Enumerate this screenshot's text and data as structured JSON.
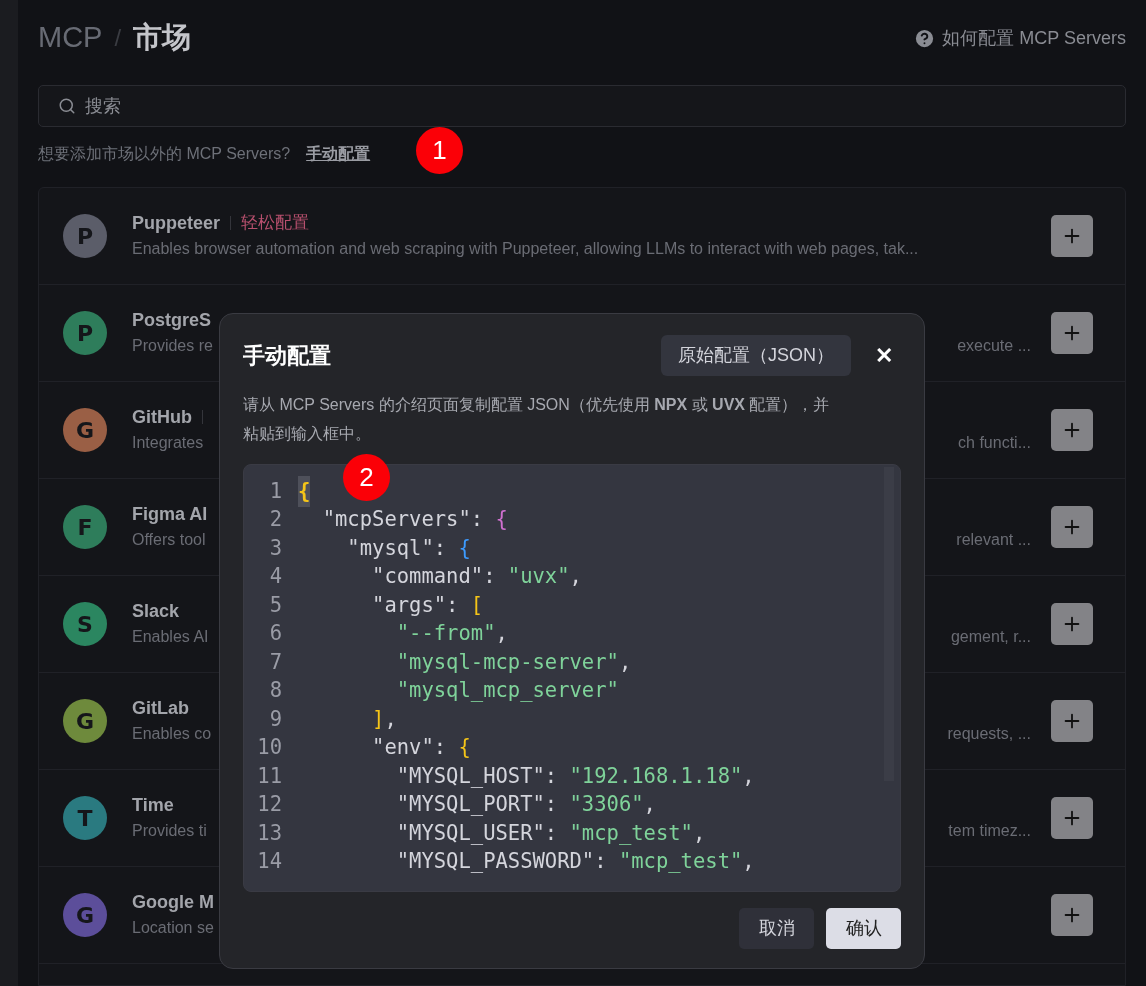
{
  "header": {
    "crumb": "MCP",
    "separator": "/",
    "title": "市场",
    "help_link": "如何配置 MCP Servers"
  },
  "search": {
    "placeholder": "搜索"
  },
  "hint": {
    "text": "想要添加市场以外的 MCP Servers?",
    "link": "手动配置"
  },
  "servers": [
    {
      "letter": "P",
      "color": "#5b5d69",
      "name": "Puppeteer",
      "has_tag": true,
      "tag": "轻松配置",
      "desc_start": "Enables browser automation and web scraping with Puppeteer, allowing LLMs to interact with web pages, tak..."
    },
    {
      "letter": "P",
      "color": "#2e7d5b",
      "name": "PostgreS",
      "has_tag": false,
      "desc_start": "Provides re",
      "desc_end": "execute ..."
    },
    {
      "letter": "G",
      "color": "#9a5f45",
      "name": "GitHub",
      "has_tag": true,
      "desc_start": "Integrates",
      "desc_end": "ch functi..."
    },
    {
      "letter": "F",
      "color": "#2e7d5b",
      "name": "Figma AI",
      "has_tag": false,
      "desc_start": "Offers tool",
      "desc_end": "relevant ..."
    },
    {
      "letter": "S",
      "color": "#2b8660",
      "name": "Slack",
      "has_tag": false,
      "desc_start": "Enables AI",
      "desc_end": "gement, r..."
    },
    {
      "letter": "G",
      "color": "#6e8a3c",
      "name": "GitLab",
      "has_tag": false,
      "desc_start": "Enables co",
      "desc_end": "requests, ..."
    },
    {
      "letter": "T",
      "color": "#2a7a80",
      "name": "Time",
      "has_tag": false,
      "desc_start": "Provides ti",
      "desc_end": "tem timez..."
    },
    {
      "letter": "G",
      "color": "#5c4e9a",
      "name": "Google M",
      "desc_start": "Location se"
    }
  ],
  "dialog": {
    "title": "手动配置",
    "mode_button": "原始配置（JSON）",
    "close": "✕",
    "description": "请从 MCP Servers 的介绍页面复制配置 JSON（优先使用 **NPX** 或 **UVX** 配置），并粘贴到输入框中。",
    "code": [
      {
        "no": "1",
        "tokens": [
          {
            "kind": "bracket",
            "text": "{",
            "color": "#f5c518",
            "highlighted": true
          }
        ]
      },
      {
        "no": "2",
        "tokens": [
          {
            "kind": "key",
            "text": "  \"mcpServers\": "
          },
          {
            "kind": "bracket",
            "text": "{",
            "color": "#d070d0",
            "highlighted": false
          }
        ]
      },
      {
        "no": "3",
        "tokens": [
          {
            "kind": "key",
            "text": "    \"mysql\": "
          },
          {
            "kind": "bracket",
            "text": "{",
            "color": "#3d9bff",
            "highlighted": false
          }
        ]
      },
      {
        "no": "4",
        "tokens": [
          {
            "kind": "key",
            "text": "      \"command\": "
          },
          {
            "kind": "string",
            "text": "\"uvx\""
          },
          {
            "kind": "punct",
            "text": ","
          }
        ]
      },
      {
        "no": "5",
        "tokens": [
          {
            "kind": "key",
            "text": "      \"args\": "
          },
          {
            "kind": "bracket",
            "text": "[",
            "color": "#f5c518",
            "highlighted": false
          }
        ]
      },
      {
        "no": "6",
        "tokens": [
          {
            "kind": "string",
            "text": "        \"--from\""
          },
          {
            "kind": "punct",
            "text": ","
          }
        ]
      },
      {
        "no": "7",
        "tokens": [
          {
            "kind": "string",
            "text": "        \"mysql-mcp-server\""
          },
          {
            "kind": "punct",
            "text": ","
          }
        ]
      },
      {
        "no": "8",
        "tokens": [
          {
            "kind": "string",
            "text": "        \"mysql_mcp_server\""
          }
        ]
      },
      {
        "no": "9",
        "tokens": [
          {
            "kind": "bracket",
            "text": "      ]",
            "color": "#f5c518",
            "highlighted": false
          },
          {
            "kind": "punct",
            "text": ","
          }
        ]
      },
      {
        "no": "10",
        "tokens": [
          {
            "kind": "key",
            "text": "      \"env\": "
          },
          {
            "kind": "bracket",
            "text": "{",
            "color": "#f5c518",
            "highlighted": false
          }
        ]
      },
      {
        "no": "11",
        "tokens": [
          {
            "kind": "key",
            "text": "        \"MYSQL_HOST\": "
          },
          {
            "kind": "string",
            "text": "\"192.168.1.18\""
          },
          {
            "kind": "punct",
            "text": ","
          }
        ]
      },
      {
        "no": "12",
        "tokens": [
          {
            "kind": "key",
            "text": "        \"MYSQL_PORT\": "
          },
          {
            "kind": "string",
            "text": "\"3306\""
          },
          {
            "kind": "punct",
            "text": ","
          }
        ]
      },
      {
        "no": "13",
        "tokens": [
          {
            "kind": "key",
            "text": "        \"MYSQL_USER\": "
          },
          {
            "kind": "string",
            "text": "\"mcp_test\""
          },
          {
            "kind": "punct",
            "text": ","
          }
        ]
      },
      {
        "no": "14",
        "tokens": [
          {
            "kind": "key",
            "text": "        \"MYSQL_PASSWORD\": "
          },
          {
            "kind": "string",
            "text": "\"mcp_test\""
          },
          {
            "kind": "punct",
            "text": ","
          }
        ]
      }
    ],
    "cancel": "取消",
    "confirm": "确认"
  },
  "annotations": [
    {
      "label": "1"
    },
    {
      "label": "2"
    }
  ]
}
